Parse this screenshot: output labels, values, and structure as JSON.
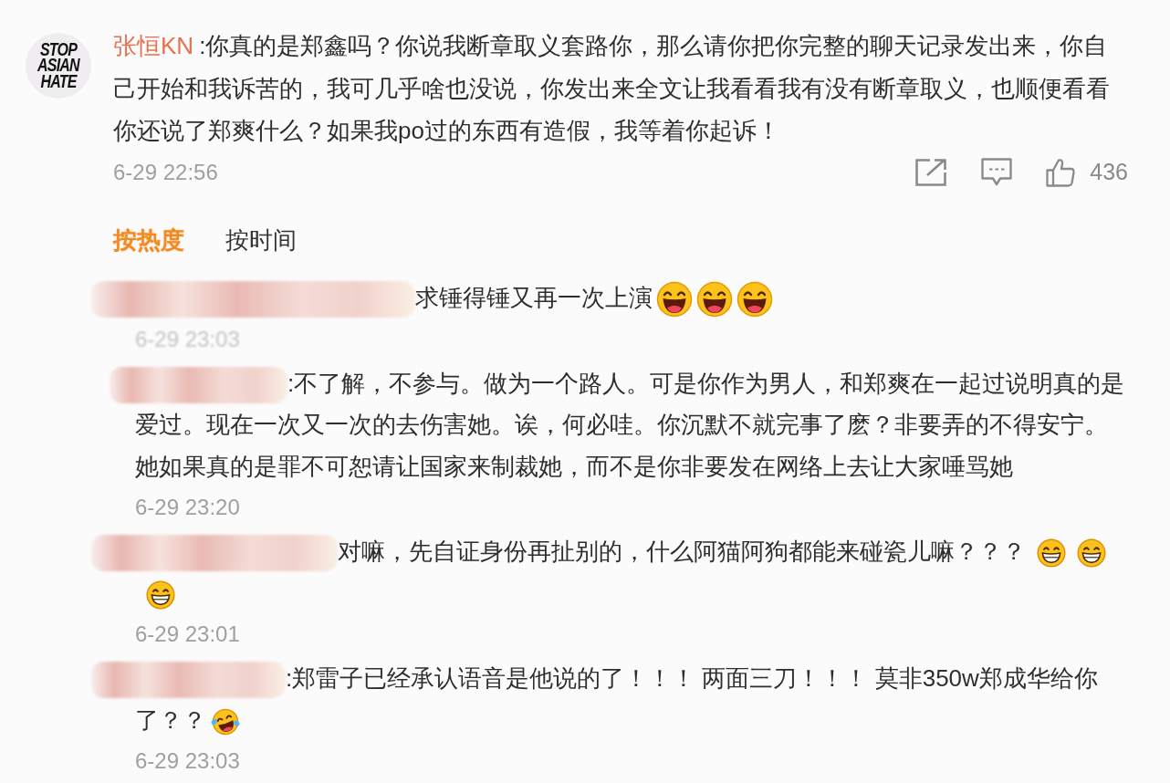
{
  "comment": {
    "avatar": {
      "lines": [
        "STOP",
        "ASIAN",
        "HATE"
      ]
    },
    "username": "张恒KN",
    "text": ":你真的是郑鑫吗？你说我断章取义套路你，那么请你把你完整的聊天记录发出来，你自己开始和我诉苦的，我可几乎啥也没说，你发出来全文让我看看我有没有断章取义，也顺便看看你还说了郑爽什么？如果我po过的东西有造假，我等着你起诉！",
    "time": "6-29 22:56",
    "actions": [
      {
        "kind": "share"
      },
      {
        "kind": "reply"
      },
      {
        "kind": "like",
        "count": "436"
      }
    ]
  },
  "sort_tabs": [
    {
      "label": "按热度",
      "selected": true
    },
    {
      "label": "按时间",
      "selected": false
    }
  ],
  "replies": [
    {
      "redacted": true,
      "text": "求锤得锤又再一次上演",
      "emojis": [
        {
          "kind": "laughing"
        },
        {
          "kind": "laughing"
        },
        {
          "kind": "laughing"
        }
      ],
      "time": "6-29 23:03",
      "time_blurred": true
    },
    {
      "redacted": true,
      "text": ":不了解，不参与。做为一个路人。可是你作为男人，和郑爽在一起过说明真的是爱过。现在一次又一次的去伤害她。诶，何必哇。你沉默不就完事了麽？非要弄的不得安宁。她如果真的是罪不可恕请让国家来制裁她，而不是你非要发在网络上去让大家唾骂她",
      "time": "6-29 23:20",
      "time_blurred": false
    },
    {
      "redacted": true,
      "text": "对嘛，先自证身份再扯别的，什么阿猫阿狗都能来碰瓷儿嘛？？？",
      "emojis": [
        {
          "kind": "grinning"
        },
        {
          "kind": "grinning"
        },
        {
          "kind": "grinning"
        }
      ],
      "time": "6-29 23:01",
      "time_blurred": false
    },
    {
      "redacted": true,
      "text": ":郑雷子已经承认语音是他说的了！！！ 两面三刀！！！ 莫非350w郑成华给你了？？",
      "emojis": [
        {
          "kind": "tears_of_joy"
        }
      ],
      "time": "6-29 23:03",
      "time_blurred": false
    }
  ]
}
